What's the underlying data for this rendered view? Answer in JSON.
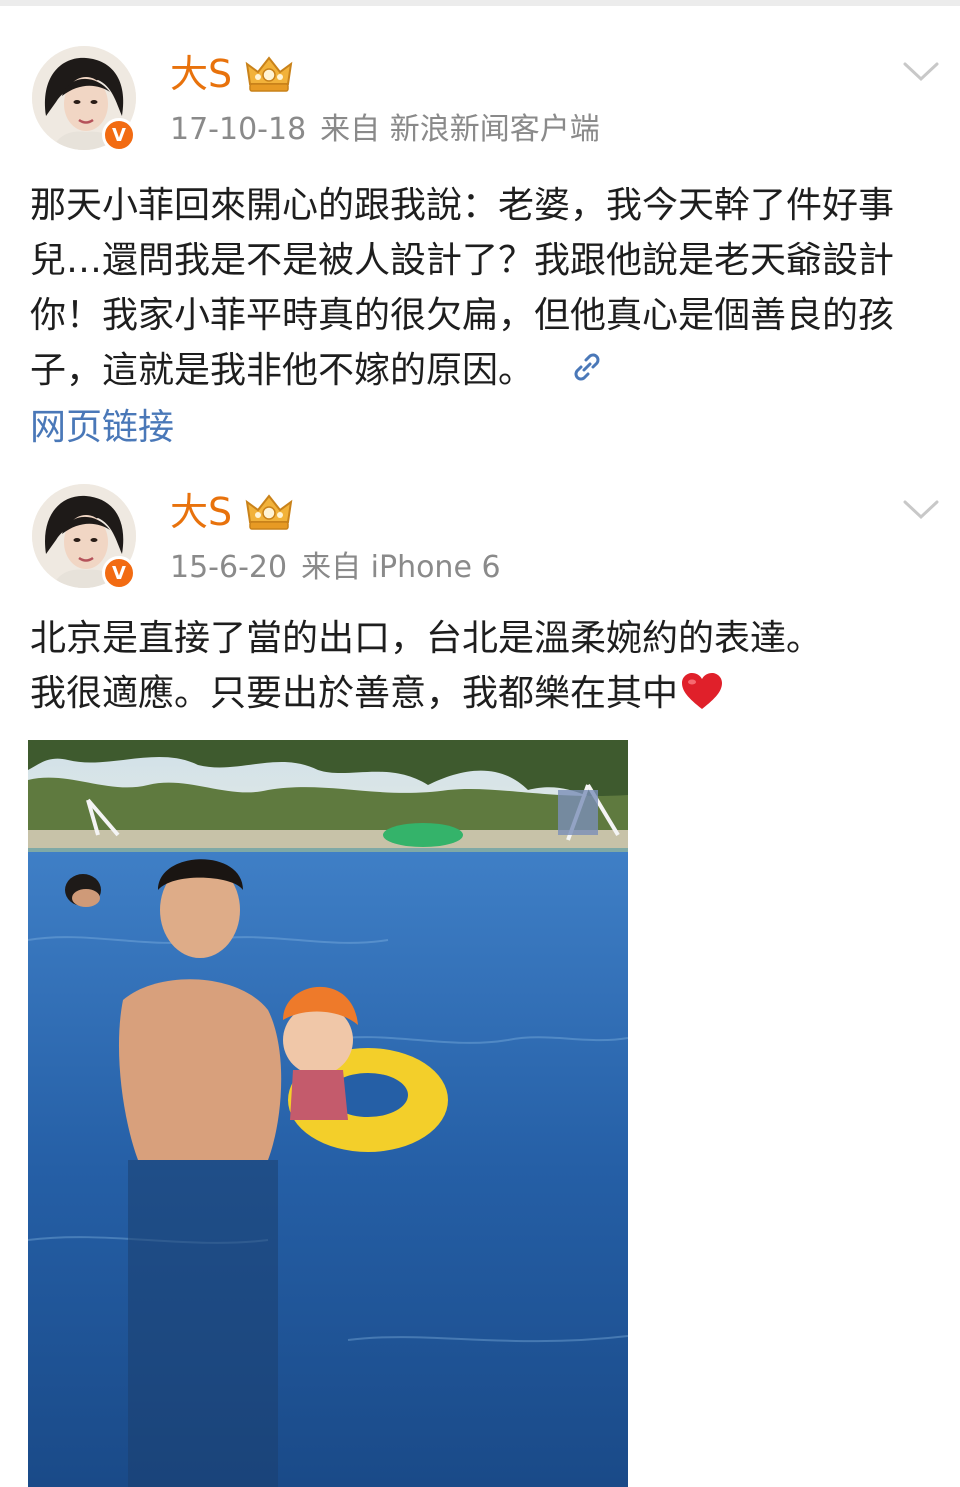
{
  "posts": [
    {
      "username": "大S",
      "date": "17-10-18",
      "source_prefix": "来自",
      "source": "新浪新闻客户端",
      "text": "那天小菲回來開心的跟我說：老婆，我今天幹了件好事兒…還問我是不是被人設計了？我跟他說是老天爺設計你！我家小菲平時真的很欠扁，但他真心是個善良的孩子，這就是我非他不嫁的原因。",
      "link_label": "网页链接"
    },
    {
      "username": "大S",
      "date": "15-6-20",
      "source_prefix": "来自",
      "source": "iPhone 6",
      "text_line1": "北京是直接了當的出口，台北是溫柔婉約的表達。",
      "text_line2": "我很適應。只要出於善意，我都樂在其中"
    }
  ],
  "badges": {
    "verified": "V"
  },
  "icons": {
    "avatar": "avatar-portrait",
    "crown": "crown-icon",
    "chevron": "chevron-down-icon",
    "link": "link-icon",
    "heart": "heart-emoji-icon"
  },
  "colors": {
    "username": "#e8720c",
    "meta": "#8a8a8a",
    "link": "#4a78b8",
    "verified": "#f26b12",
    "heart": "#e0202a"
  }
}
